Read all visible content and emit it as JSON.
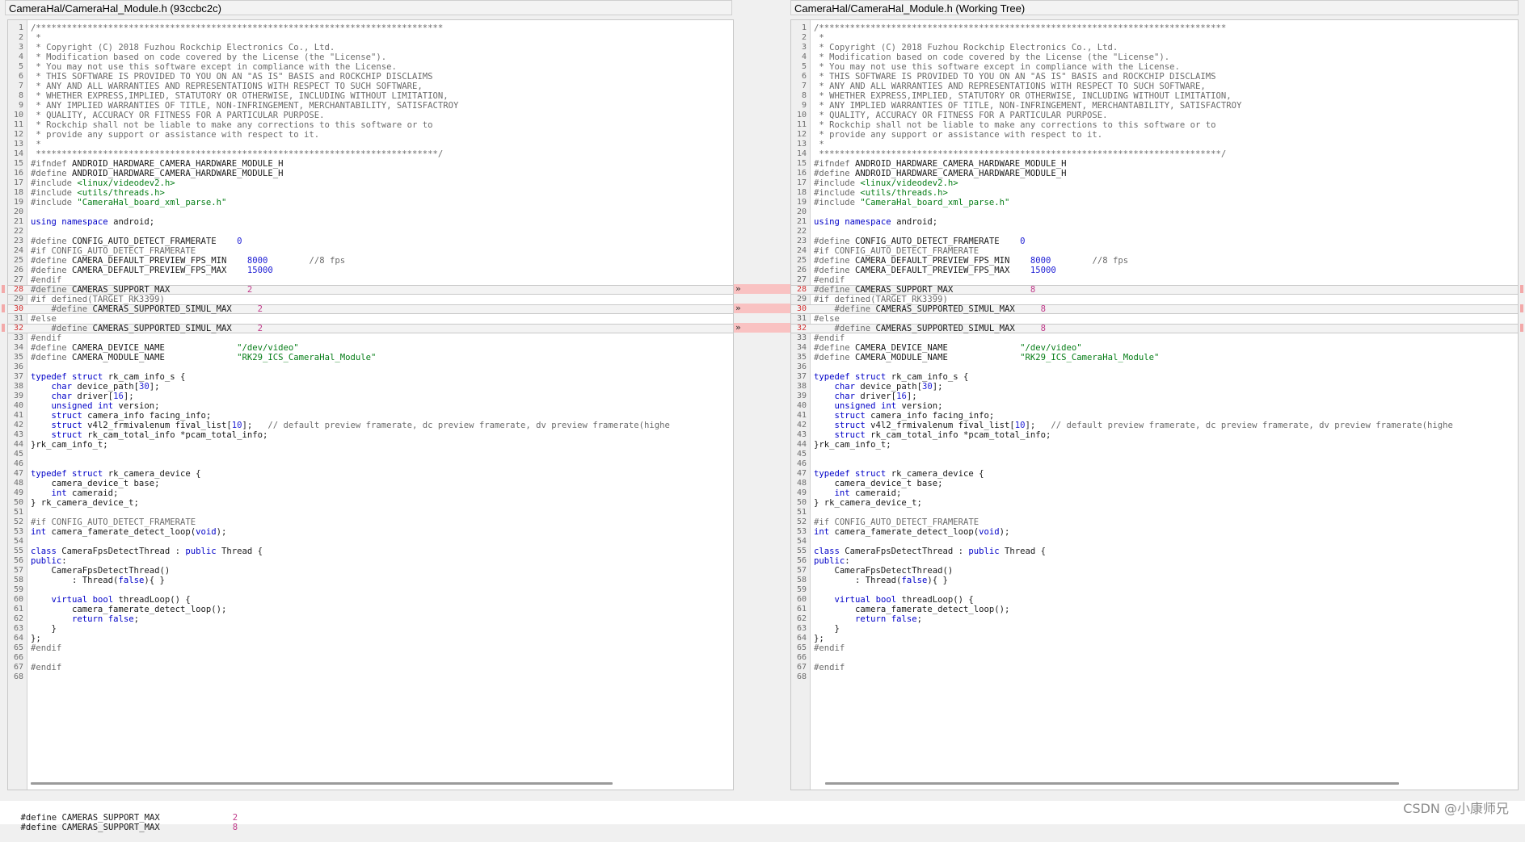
{
  "left_title": "CameraHal/CameraHal_Module.h (93ccbc2c)",
  "right_title": "CameraHal/CameraHal_Module.h (Working Tree)",
  "arrow_glyph": "»",
  "bottom_line_1_prefix": "#define CAMERAS_SUPPORT_MAX",
  "bottom_line_1_value": "2",
  "bottom_line_2_prefix": "#define CAMERAS_SUPPORT_MAX",
  "bottom_line_2_value": "8",
  "watermark": "CSDN @小康师兄",
  "colors": {
    "diff_marker": "#f9c2c2",
    "changed_value": "#c03a8a"
  },
  "left_lines": [
    "/*******************************************************************************",
    " *",
    " * Copyright (C) 2018 Fuzhou Rockchip Electronics Co., Ltd.",
    " * Modification based on code covered by the License (the \"License\").",
    " * You may not use this software except in compliance with the License.",
    " * THIS SOFTWARE IS PROVIDED TO YOU ON AN \"AS IS\" BASIS and ROCKCHIP DISCLAIMS",
    " * ANY AND ALL WARRANTIES AND REPRESENTATIONS WITH RESPECT TO SUCH SOFTWARE,",
    " * WHETHER EXPRESS,IMPLIED, STATUTORY OR OTHERWISE, INCLUDING WITHOUT LIMITATION,",
    " * ANY IMPLIED WARRANTIES OF TITLE, NON-INFRINGEMENT, MERCHANTABILITY, SATISFACTROY",
    " * QUALITY, ACCURACY OR FITNESS FOR A PARTICULAR PURPOSE.",
    " * Rockchip shall not be liable to make any corrections to this software or to",
    " * provide any support or assistance with respect to it.",
    " *",
    " ******************************************************************************/",
    "#ifndef ANDROID_HARDWARE_CAMERA_HARDWARE_MODULE_H",
    "#define ANDROID_HARDWARE_CAMERA_HARDWARE_MODULE_H",
    "#include <linux/videodev2.h>",
    "#include <utils/threads.h>",
    "#include \"CameraHal_board_xml_parse.h\"",
    "",
    "using namespace android;",
    "",
    "#define CONFIG_AUTO_DETECT_FRAMERATE    0",
    "#if CONFIG_AUTO_DETECT_FRAMERATE",
    "#define CAMERA_DEFAULT_PREVIEW_FPS_MIN    8000        //8 fps",
    "#define CAMERA_DEFAULT_PREVIEW_FPS_MAX    15000",
    "#endif",
    "#define CAMERAS_SUPPORT_MAX               2",
    "#if defined(TARGET_RK3399)",
    "    #define CAMERAS_SUPPORTED_SIMUL_MAX     2",
    "#else",
    "    #define CAMERAS_SUPPORTED_SIMUL_MAX     2",
    "#endif",
    "#define CAMERA_DEVICE_NAME              \"/dev/video\"",
    "#define CAMERA_MODULE_NAME              \"RK29_ICS_CameraHal_Module\"",
    "",
    "typedef struct rk_cam_info_s {",
    "    char device_path[30];",
    "    char driver[16];",
    "    unsigned int version;",
    "    struct camera_info facing_info;",
    "    struct v4l2_frmivalenum fival_list[10];   // default preview framerate, dc preview framerate, dv preview framerate(highe",
    "    struct rk_cam_total_info *pcam_total_info;",
    "}rk_cam_info_t;",
    "",
    "",
    "typedef struct rk_camera_device {",
    "    camera_device_t base;",
    "    int cameraid;",
    "} rk_camera_device_t;",
    "",
    "#if CONFIG_AUTO_DETECT_FRAMERATE",
    "int camera_famerate_detect_loop(void);",
    "",
    "class CameraFpsDetectThread : public Thread {",
    "public:",
    "    CameraFpsDetectThread()",
    "        : Thread(false){ }",
    "",
    "    virtual bool threadLoop() {",
    "        camera_famerate_detect_loop();",
    "        return false;",
    "    }",
    "};",
    "#endif",
    "",
    "#endif",
    ""
  ],
  "right_lines": [
    "/*******************************************************************************",
    " *",
    " * Copyright (C) 2018 Fuzhou Rockchip Electronics Co., Ltd.",
    " * Modification based on code covered by the License (the \"License\").",
    " * You may not use this software except in compliance with the License.",
    " * THIS SOFTWARE IS PROVIDED TO YOU ON AN \"AS IS\" BASIS and ROCKCHIP DISCLAIMS",
    " * ANY AND ALL WARRANTIES AND REPRESENTATIONS WITH RESPECT TO SUCH SOFTWARE,",
    " * WHETHER EXPRESS,IMPLIED, STATUTORY OR OTHERWISE, INCLUDING WITHOUT LIMITATION,",
    " * ANY IMPLIED WARRANTIES OF TITLE, NON-INFRINGEMENT, MERCHANTABILITY, SATISFACTROY",
    " * QUALITY, ACCURACY OR FITNESS FOR A PARTICULAR PURPOSE.",
    " * Rockchip shall not be liable to make any corrections to this software or to",
    " * provide any support or assistance with respect to it.",
    " *",
    " ******************************************************************************/",
    "#ifndef ANDROID_HARDWARE_CAMERA_HARDWARE_MODULE_H",
    "#define ANDROID_HARDWARE_CAMERA_HARDWARE_MODULE_H",
    "#include <linux/videodev2.h>",
    "#include <utils/threads.h>",
    "#include \"CameraHal_board_xml_parse.h\"",
    "",
    "using namespace android;",
    "",
    "#define CONFIG_AUTO_DETECT_FRAMERATE    0",
    "#if CONFIG_AUTO_DETECT_FRAMERATE",
    "#define CAMERA_DEFAULT_PREVIEW_FPS_MIN    8000        //8 fps",
    "#define CAMERA_DEFAULT_PREVIEW_FPS_MAX    15000",
    "#endif",
    "#define CAMERAS_SUPPORT_MAX               8",
    "#if defined(TARGET_RK3399)",
    "    #define CAMERAS_SUPPORTED_SIMUL_MAX     8",
    "#else",
    "    #define CAMERAS_SUPPORTED_SIMUL_MAX     8",
    "#endif",
    "#define CAMERA_DEVICE_NAME              \"/dev/video\"",
    "#define CAMERA_MODULE_NAME              \"RK29_ICS_CameraHal_Module\"",
    "",
    "typedef struct rk_cam_info_s {",
    "    char device_path[30];",
    "    char driver[16];",
    "    unsigned int version;",
    "    struct camera_info facing_info;",
    "    struct v4l2_frmivalenum fival_list[10];   // default preview framerate, dc preview framerate, dv preview framerate(highe",
    "    struct rk_cam_total_info *pcam_total_info;",
    "}rk_cam_info_t;",
    "",
    "",
    "typedef struct rk_camera_device {",
    "    camera_device_t base;",
    "    int cameraid;",
    "} rk_camera_device_t;",
    "",
    "#if CONFIG_AUTO_DETECT_FRAMERATE",
    "int camera_famerate_detect_loop(void);",
    "",
    "class CameraFpsDetectThread : public Thread {",
    "public:",
    "    CameraFpsDetectThread()",
    "        : Thread(false){ }",
    "",
    "    virtual bool threadLoop() {",
    "        camera_famerate_detect_loop();",
    "        return false;",
    "    }",
    "};",
    "#endif",
    "",
    "#endif",
    ""
  ],
  "diff_lines": [
    28,
    30,
    32
  ]
}
